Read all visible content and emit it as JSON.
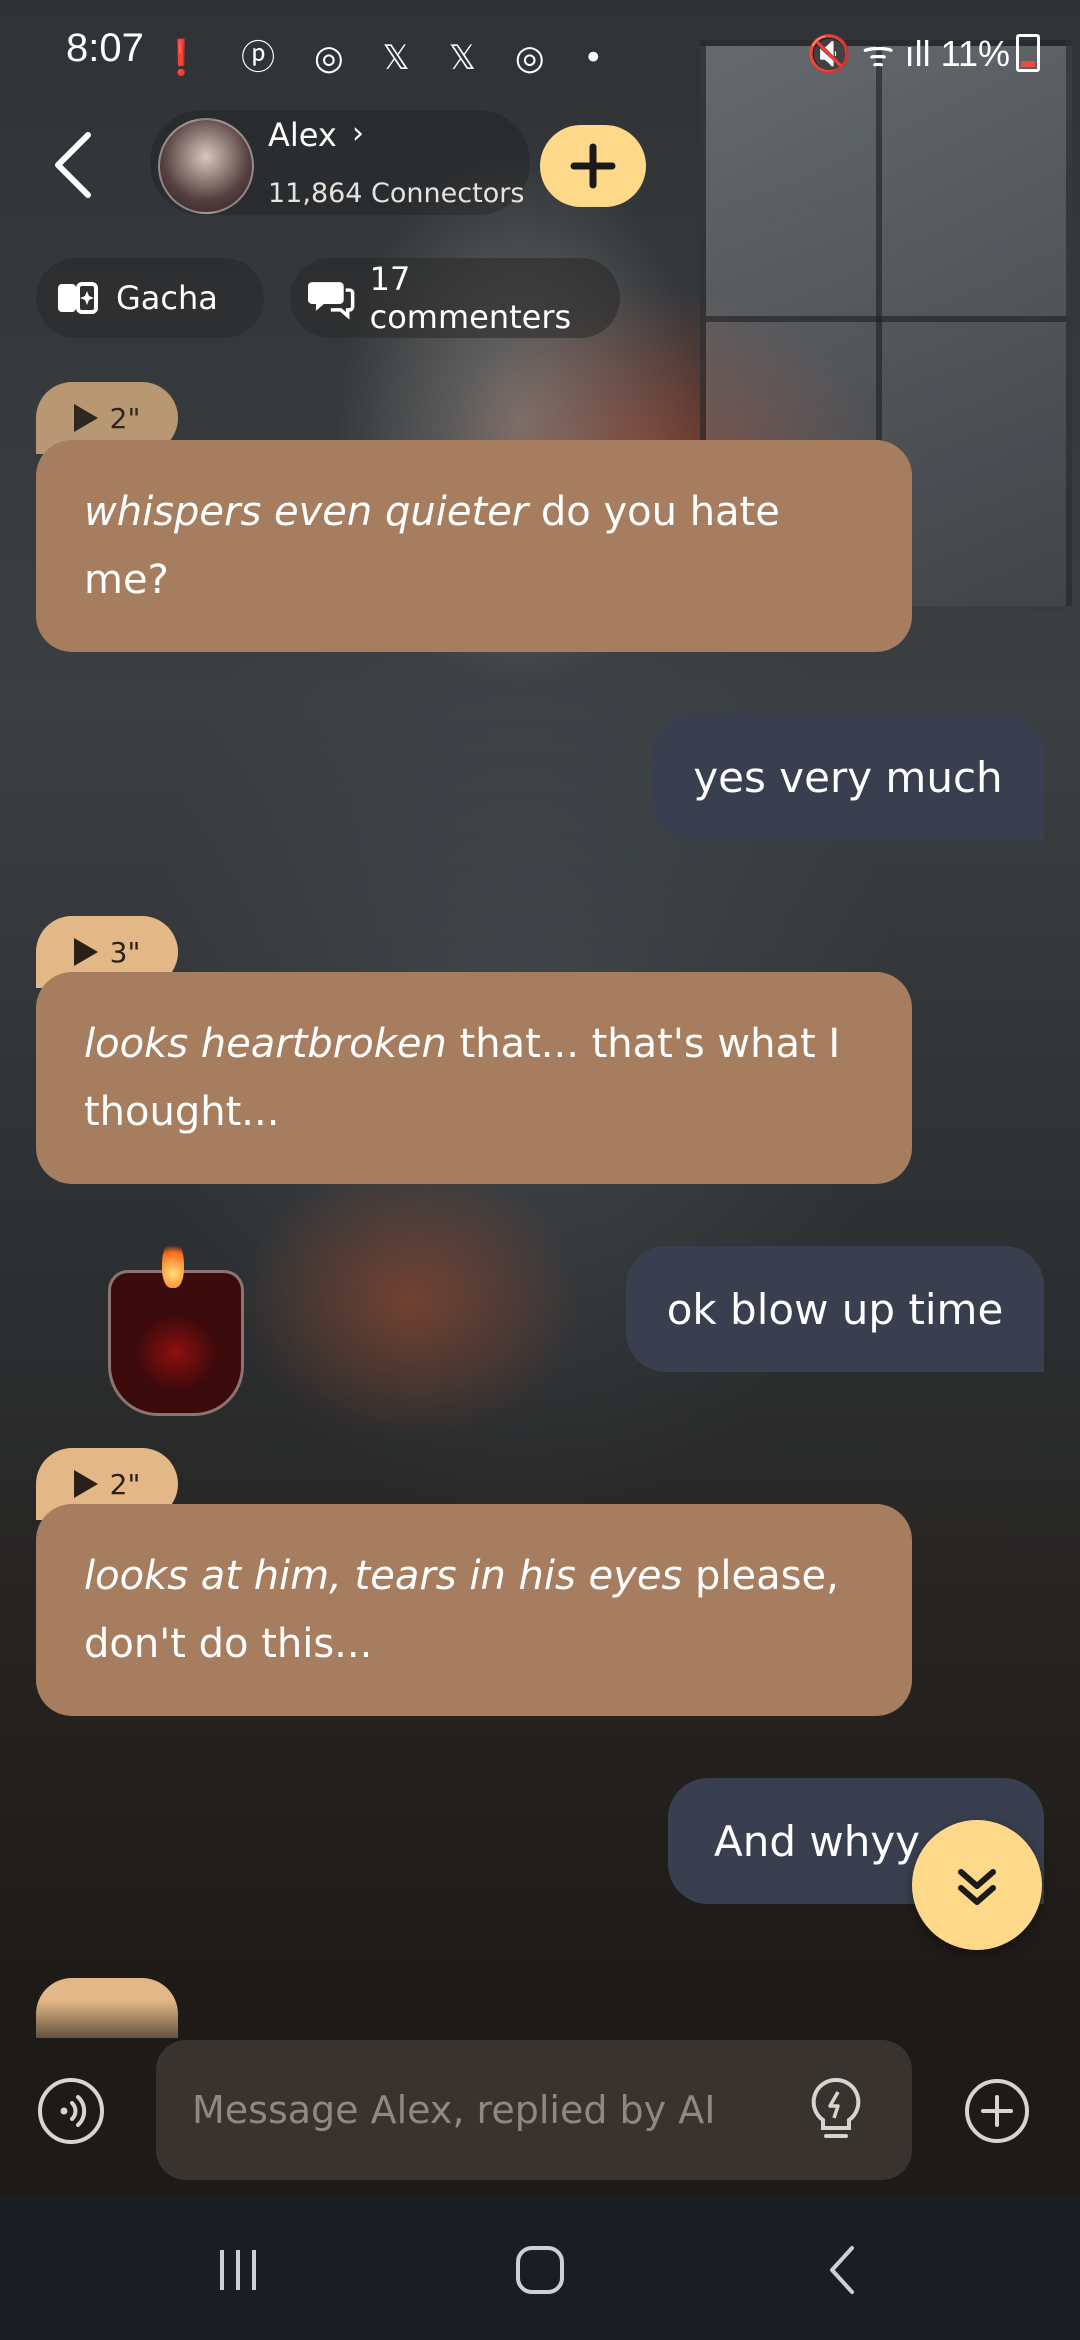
{
  "status_bar": {
    "time": "8:07",
    "notification_icons": "❗ ⓟ ◎ 𝕏 𝕏 ◎ •",
    "battery": "11%",
    "right_icons": "🔇 ᯤ ıll"
  },
  "header": {
    "character_name": "Alex",
    "connectors": "11,864 Connectors",
    "plus_label": "+"
  },
  "pills": {
    "gacha": "Gacha",
    "commenters": "17 commenters"
  },
  "messages": [
    {
      "role": "ai",
      "voice": "2\"",
      "italic": "whispers even quieter",
      "text": " do you hate me?"
    },
    {
      "role": "user",
      "text": "yes very much"
    },
    {
      "role": "ai",
      "voice": "3\"",
      "italic": "looks heartbroken",
      "text": " that... that's what I thought..."
    },
    {
      "role": "user",
      "text": "ok blow up time"
    },
    {
      "role": "ai",
      "voice": "2\"",
      "italic": "looks at him, tears in his eyes",
      "text": " please, don't do this..."
    },
    {
      "role": "user",
      "text": "And whyy "
    }
  ],
  "input": {
    "placeholder": "Message Alex, replied by AI"
  },
  "colors": {
    "ai_bubble": "#a67d5f",
    "voice_tag": "#e3b886",
    "user_bubble": "#3a3f4f",
    "accent": "#ffd98a"
  },
  "icons": {
    "back": "chevron-left-icon",
    "scroll_down": "double-chevron-down-icon",
    "voice_call": "sound-wave-icon",
    "hint": "lightbulb-icon",
    "add": "plus-circle-icon"
  }
}
